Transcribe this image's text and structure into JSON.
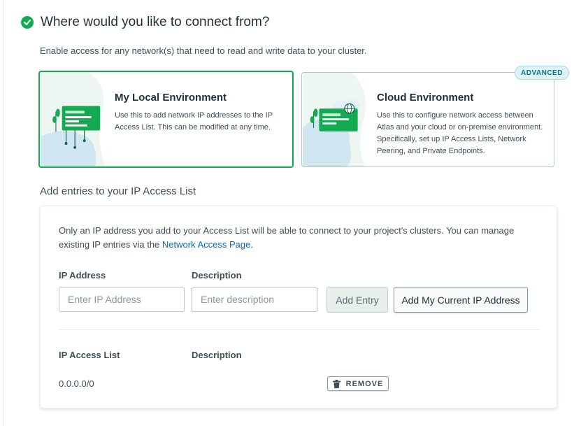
{
  "header": {
    "title": "Where would you like to connect from?",
    "subtitle": "Enable access for any network(s) that need to read and write data to your cluster."
  },
  "options": {
    "local": {
      "title": "My Local Environment",
      "description": "Use this to add network IP addresses to the IP Access List. This can be modified at any time.",
      "selected": true
    },
    "cloud": {
      "title": "Cloud Environment",
      "description": "Use this to configure network access between Atlas and your cloud or on-premise environment. Specifically, set up IP Access Lists, Network Peering, and Private Endpoints.",
      "badge": "ADVANCED"
    }
  },
  "access_list": {
    "section_title": "Add entries to your IP Access List",
    "intro_text": "Only an IP address you add to your Access List will be able to connect to your project's clusters. You can manage existing IP entries via the ",
    "intro_link": "Network Access Page",
    "intro_end": ".",
    "ip_label": "IP Address",
    "ip_placeholder": "Enter IP Address",
    "desc_label": "Description",
    "desc_placeholder": "Enter description",
    "add_entry_label": "Add Entry",
    "add_current_ip_label": "Add My Current IP Address",
    "list_header_ip": "IP Access List",
    "list_header_desc": "Description",
    "entries": [
      {
        "ip": "0.0.0.0/0",
        "description": "",
        "remove_label": "REMOVE"
      }
    ]
  },
  "colors": {
    "accent_green": "#13aa52",
    "link_blue": "#006cbc",
    "badge_blue": "#0d7090"
  }
}
